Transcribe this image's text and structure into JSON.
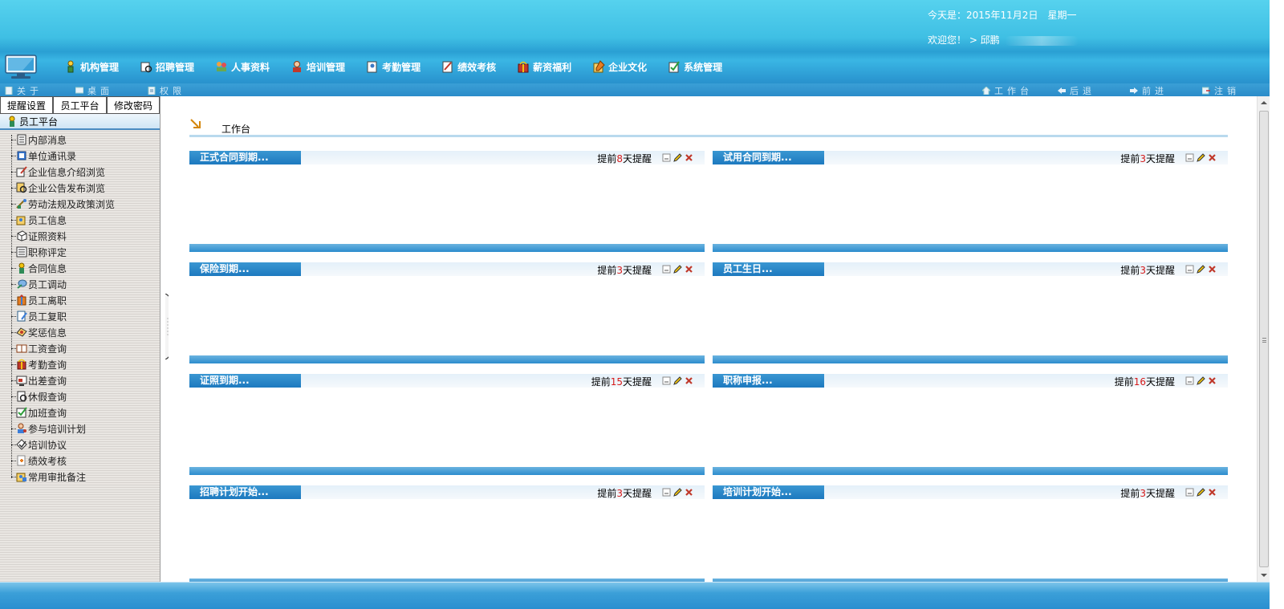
{
  "header": {
    "date_label": "今天是：2015年11月2日",
    "weekday": "星期一",
    "welcome": "欢迎您！ > 邱鹏"
  },
  "main_nav": [
    {
      "label": "机构管理",
      "icon": "organization-icon"
    },
    {
      "label": "招聘管理",
      "icon": "recruitment-icon"
    },
    {
      "label": "人事资料",
      "icon": "personnel-icon"
    },
    {
      "label": "培训管理",
      "icon": "training-icon"
    },
    {
      "label": "考勤管理",
      "icon": "attendance-icon"
    },
    {
      "label": "绩效考核",
      "icon": "performance-icon"
    },
    {
      "label": "薪资福利",
      "icon": "salary-icon"
    },
    {
      "label": "企业文化",
      "icon": "culture-icon"
    },
    {
      "label": "系统管理",
      "icon": "system-icon"
    }
  ],
  "sub_toolbar": {
    "left": [
      {
        "label": "关于",
        "icon": "page-icon"
      },
      {
        "label": "桌面",
        "icon": "desktop-icon"
      },
      {
        "label": "权限",
        "icon": "permission-icon"
      }
    ],
    "right": [
      {
        "label": "工作台",
        "icon": "home-icon"
      },
      {
        "label": "后退",
        "icon": "back-icon"
      },
      {
        "label": "前进",
        "icon": "forward-icon"
      },
      {
        "label": "注销",
        "icon": "logout-icon"
      }
    ]
  },
  "sidebar": {
    "tabs": [
      "提醒设置",
      "员工平台",
      "修改密码"
    ],
    "section_title": "员工平台",
    "items": [
      {
        "label": "内部消息",
        "icon": "message-icon"
      },
      {
        "label": "单位通讯录",
        "icon": "address-book-icon"
      },
      {
        "label": "企业信息介绍浏览",
        "icon": "pencil-note-icon"
      },
      {
        "label": "企业公告发布浏览",
        "icon": "announcement-icon"
      },
      {
        "label": "劳动法规及政策浏览",
        "icon": "regulation-icon"
      },
      {
        "label": "员工信息",
        "icon": "employee-info-icon"
      },
      {
        "label": "证照资料",
        "icon": "certificate-icon"
      },
      {
        "label": "职称评定",
        "icon": "title-review-icon"
      },
      {
        "label": "合同信息",
        "icon": "contract-icon"
      },
      {
        "label": "员工调动",
        "icon": "transfer-icon"
      },
      {
        "label": "员工离职",
        "icon": "resignation-icon"
      },
      {
        "label": "员工复职",
        "icon": "reinstatement-icon"
      },
      {
        "label": "奖惩信息",
        "icon": "reward-icon"
      },
      {
        "label": "工资查询",
        "icon": "salary-book-icon"
      },
      {
        "label": "考勤查询",
        "icon": "attendance-query-icon"
      },
      {
        "label": "出差查询",
        "icon": "business-trip-icon"
      },
      {
        "label": "休假查询",
        "icon": "leave-icon"
      },
      {
        "label": "加班查询",
        "icon": "overtime-icon"
      },
      {
        "label": "参与培训计划",
        "icon": "training-plan-icon"
      },
      {
        "label": "培训协议",
        "icon": "agreement-icon"
      },
      {
        "label": "绩效考核",
        "icon": "assessment-icon"
      },
      {
        "label": "常用审批备注",
        "icon": "approval-note-icon"
      }
    ]
  },
  "workspace": {
    "breadcrumb": "工作台",
    "panels": [
      {
        "title": "正式合同到期...",
        "remind_prefix": "提前",
        "days": "8",
        "remind_suffix": "天提醒"
      },
      {
        "title": "试用合同到期...",
        "remind_prefix": "提前",
        "days": "3",
        "remind_suffix": "天提醒"
      },
      {
        "title": "保险到期...",
        "remind_prefix": "提前",
        "days": "3",
        "remind_suffix": "天提醒"
      },
      {
        "title": "员工生日...",
        "remind_prefix": "提前",
        "days": "3",
        "remind_suffix": "天提醒"
      },
      {
        "title": "证照到期...",
        "remind_prefix": "提前",
        "days": "15",
        "remind_suffix": "天提醒"
      },
      {
        "title": "职称申报...",
        "remind_prefix": "提前",
        "days": "16",
        "remind_suffix": "天提醒"
      },
      {
        "title": "招聘计划开始...",
        "remind_prefix": "提前",
        "days": "3",
        "remind_suffix": "天提醒"
      },
      {
        "title": "培训计划开始...",
        "remind_prefix": "提前",
        "days": "3",
        "remind_suffix": "天提醒"
      }
    ]
  },
  "colors": {
    "header_top": "#56d2ee",
    "header_bottom": "#2891cd",
    "panel_title": "#1d79bf",
    "remind_number": "#d51b1b"
  }
}
